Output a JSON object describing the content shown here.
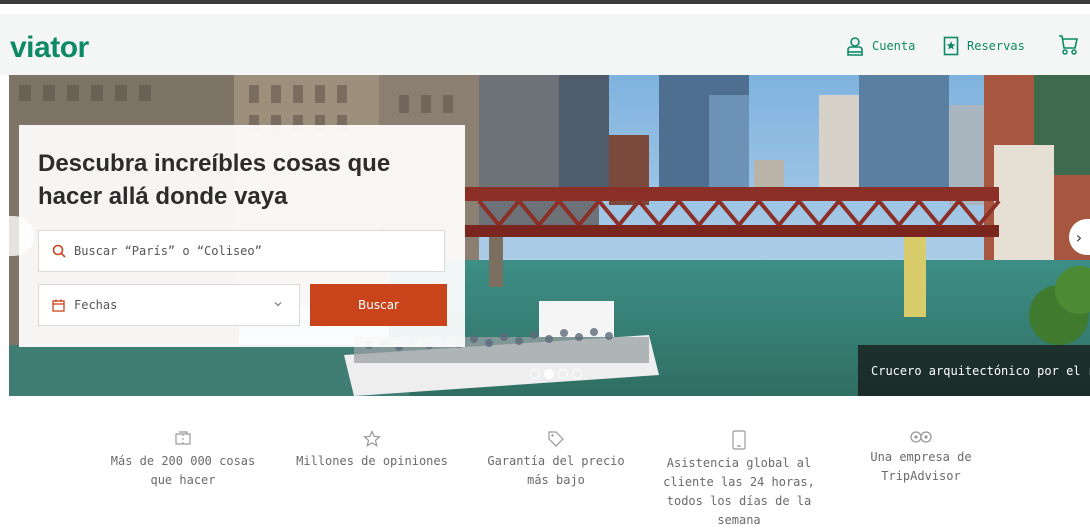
{
  "header": {
    "logo": "viator",
    "account_label": "Cuenta",
    "reservations_label": "Reservas"
  },
  "hero": {
    "title": "Descubra increíbles cosas que hacer allá donde vaya",
    "search_placeholder": "Buscar “París” o “Coliseo”",
    "dates_label": "Fechas",
    "search_button": "Buscar",
    "caption": "Crucero arquitectónico por el río",
    "carousel_active_index": 1,
    "carousel_count": 3
  },
  "features": [
    {
      "icon": "ticket-icon",
      "text": "Más de 200 000 cosas que hacer"
    },
    {
      "icon": "star-icon",
      "text": "Millones de opiniones"
    },
    {
      "icon": "price-tag-icon",
      "text": "Garantía del precio más bajo"
    },
    {
      "icon": "phone-icon",
      "text": "Asistencia global al cliente las 24 horas, todos los días de la semana"
    },
    {
      "icon": "owl-icon",
      "text": "Una empresa de TripAdvisor"
    }
  ],
  "colors": {
    "brand_green": "#0d8a63",
    "button_orange": "#c9441b"
  }
}
